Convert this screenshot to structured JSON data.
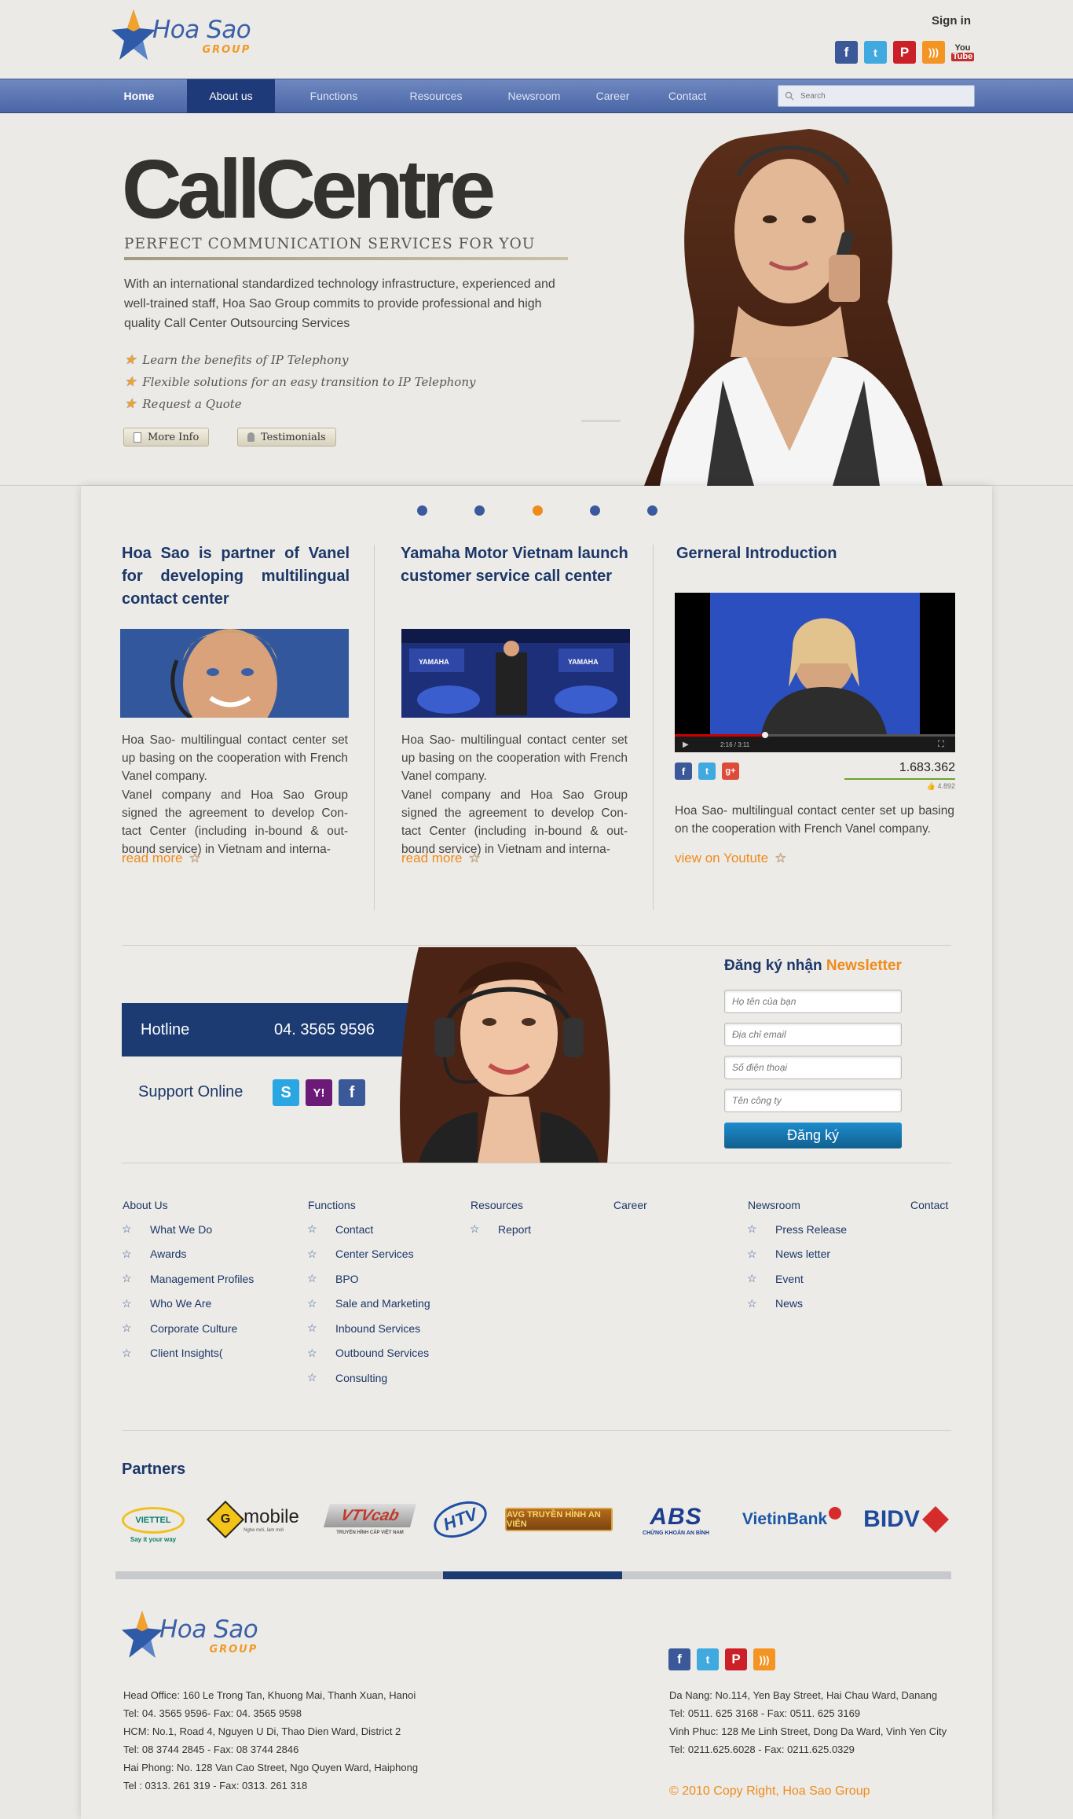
{
  "header": {
    "logo_text": "Hoa Sao",
    "logo_sub": "GROUP",
    "signin": "Sign in",
    "social": [
      {
        "icon": "facebook-icon",
        "glyph": "f",
        "color": "#3b5998"
      },
      {
        "icon": "twitter-icon",
        "glyph": "t",
        "color": "#3fa9e0"
      },
      {
        "icon": "pinterest-icon",
        "glyph": "P",
        "color": "#cb2027"
      },
      {
        "icon": "rss-icon",
        "glyph": "))",
        "color": "#f39423"
      },
      {
        "icon": "youtube-icon",
        "glyph": "You",
        "color": "#c4302b"
      }
    ]
  },
  "nav": {
    "items": [
      "Home",
      "About us",
      "Functions",
      "Resources",
      "Newsroom",
      "Career",
      "Contact"
    ],
    "active": "About us",
    "search_placeholder": "Search"
  },
  "hero": {
    "title": "CallCentre",
    "subtitle": "PERFECT COMMUNICATION SERVICES FOR YOU",
    "description": "With an international standardized technology infrastructure, experienced and well-trained staff, Hoa Sao Group commits to provide professional and high quality Call Center Outsourcing Services",
    "bullets": [
      "Learn the benefits of IP Telephony",
      "Flexible solutions for an easy transition to IP Telephony",
      "Request a Quote"
    ],
    "btn_more": "More Info",
    "btn_testimonials": "Testimonials",
    "slider_active_index": 2
  },
  "columns": [
    {
      "title": "Hoa Sao is partner of Vanel for developing multilingual contact center",
      "para1": "Hoa Sao- multilingual contact center set up basing on the cooperation with French Vanel company.",
      "para2": "Vanel company and Hoa Sao Group signed the agreement to develop Con-tact Center (including in-bound & out-bound service) in Vietnam and interna-",
      "link": "read more"
    },
    {
      "title": "Yamaha Motor Vietnam launch customer service call center",
      "para1": "Hoa Sao- multilingual contact center set up basing on the cooperation with French Vanel company.",
      "para2": "Vanel company and Hoa Sao Group signed the agreement to develop Con-tact Center (including in-bound & out-bound service) in Vietnam and interna-",
      "link": "read more"
    },
    {
      "title": "Gerneral Introduction",
      "views": "1.683.362",
      "likes": "4.892",
      "video_time": "2:16 / 3:11",
      "para1": "Hoa Sao- multilingual contact center set up basing on the cooperation with French Vanel company.",
      "link": "view on Youtute"
    }
  ],
  "contact": {
    "hotline_label": "Hotline",
    "hotline_number": "04. 3565 9596",
    "support_label": "Support Online"
  },
  "newsletter": {
    "title_a": "Đăng ký nhận",
    "title_b": "Newsletter",
    "placeholders": [
      "Họ tên của bạn",
      "Địa chỉ email",
      "Số điện thoại",
      "Tên công ty"
    ],
    "submit": "Đăng ký"
  },
  "footer_menu": {
    "about": {
      "head": "About Us",
      "links": [
        "What We Do",
        "Awards",
        "Management Profiles",
        "Who We Are",
        "Corporate Culture",
        "Client Insights("
      ]
    },
    "functions": {
      "head": "Functions",
      "links": [
        "Contact",
        "Center Services",
        "BPO",
        "Sale and Marketing",
        "Inbound Services",
        "Outbound Services",
        "Consulting"
      ]
    },
    "resources": {
      "head": "Resources",
      "links": [
        "Report"
      ]
    },
    "career": {
      "head": "Career"
    },
    "newsroom": {
      "head": "Newsroom",
      "links": [
        "Press Release",
        "News letter",
        "Event",
        "News"
      ]
    },
    "contact": {
      "head": "Contact"
    }
  },
  "partners": {
    "title": "Partners",
    "logos": [
      {
        "text": "VIETTEL",
        "sub": "Say it your way",
        "color": "#0b7d6e"
      },
      {
        "text": "mobile",
        "sub": "Nghe mới, làm mới",
        "color": "#222"
      },
      {
        "text": "VTVcab",
        "sub": "TRUYỀN HÌNH CÁP VIỆT NAM",
        "color": "#c0392b"
      },
      {
        "text": "HTV",
        "sub": "",
        "color": "#1f4fa3"
      },
      {
        "text": "AVG TRUYỀN HÌNH AN VIÊN",
        "sub": "",
        "color": "#9a5b15"
      },
      {
        "text": "ABS",
        "sub": "CHỨNG KHOÁN AN BÌNH",
        "color": "#1c3c90"
      },
      {
        "text": "VietinBank",
        "sub": "",
        "color": "#1a56a6"
      },
      {
        "text": "BIDV",
        "sub": "",
        "color": "#1f4a9c"
      }
    ]
  },
  "footer": {
    "logo_text": "Hoa Sao",
    "logo_sub": "GROUP",
    "left_lines": [
      "Head Office: 160 Le Trong Tan,  Khuong Mai, Thanh Xuan, Hanoi",
      "Tel: 04. 3565 9596- Fax: 04. 3565 9598",
      "HCM: No.1, Road 4, Nguyen U Di, Thao Dien Ward, District 2",
      "Tel: 08 3744 2845 - Fax: 08 3744 2846",
      "Hai Phong: No. 128 Van Cao Street, Ngo Quyen Ward, Haiphong",
      "Tel : 0313. 261 319 - Fax: 0313. 261 318"
    ],
    "right_lines": [
      "Da Nang: No.114, Yen Bay Street, Hai Chau Ward, Danang",
      "Tel: 0511. 625 3168 - Fax: 0511. 625 3169",
      "Vinh Phuc: 128 Me Linh Street, Dong Da Ward, Vinh Yen City",
      "Tel: 0211.625.6028 - Fax: 0211.625.0329"
    ],
    "copyright": "© 2010 Copy Right, Hoa Sao Group"
  }
}
